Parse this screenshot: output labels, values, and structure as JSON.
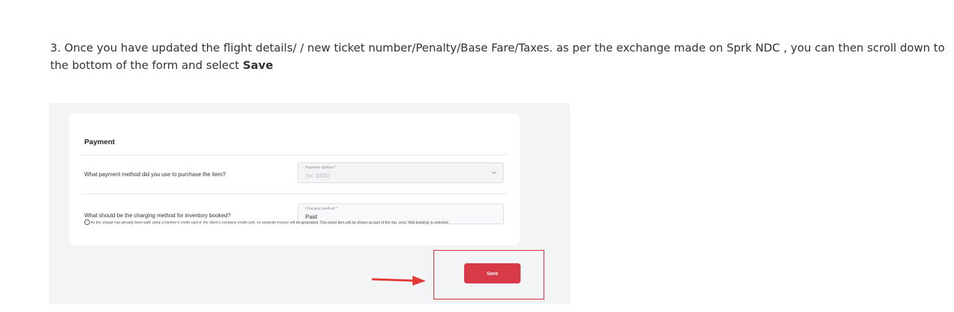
{
  "instruction": {
    "prefix": "3. Once you have updated the flight details/ / new ticket number/Penalty/Base Fare/Taxes. as per the exchange made on Sprk NDC , you can then scroll down to the bottom of the form and select ",
    "bold": "Save"
  },
  "payment_card": {
    "title": "Payment",
    "question_1": "What payment method did you use to purchase the item?",
    "payment_field": {
      "label": "Payment options *",
      "value": "(xx 3005)",
      "icon": "chevron-down-icon"
    },
    "question_2": "What should be the charging method for inventory booked?",
    "charging_field": {
      "label": "Charging method *",
      "value": "Paid"
    },
    "note_icon": "info-icon",
    "note": "As the charge has already been paid using a traveler's credit card or the client's company credit card, no separate invoice will be generated. This travel item will be shown as part of the trip, once 'Add booking' is selected."
  },
  "save_button": {
    "label": "Save",
    "color": "#d93a48"
  },
  "annotation": {
    "highlight_color": "#d7242c",
    "arrow_color": "#e53935"
  }
}
